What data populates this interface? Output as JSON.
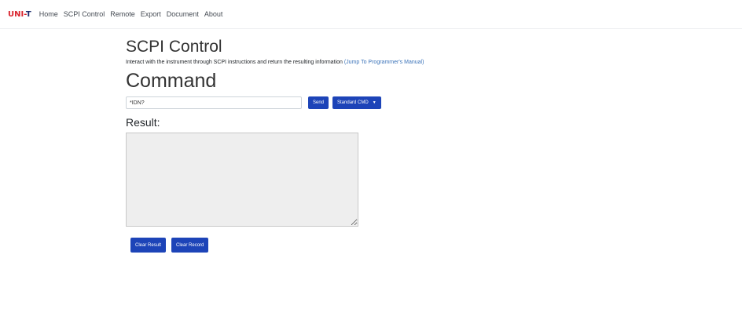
{
  "nav": {
    "brand": "UNI-T",
    "links": [
      "Home",
      "SCPI Control",
      "Remote",
      "Export",
      "Document",
      "About"
    ]
  },
  "page": {
    "title": "SCPI Control",
    "intro_text": "Interact with the instrument through SCPI instructions and return the resulting information",
    "manual_link": "(Jump To Programmer's Manual)"
  },
  "command": {
    "heading": "Command",
    "input_value": "*IDN?",
    "send_label": "Send",
    "standard_cmd_label": "Standard CMD"
  },
  "result": {
    "label": "Result:",
    "value": ""
  },
  "actions": {
    "clear_result": "Clear Result",
    "clear_record": "Clear Record"
  },
  "colors": {
    "brand_red": "#d9232d",
    "button_blue": "#1d44b8",
    "link_blue": "#3b73b9"
  }
}
